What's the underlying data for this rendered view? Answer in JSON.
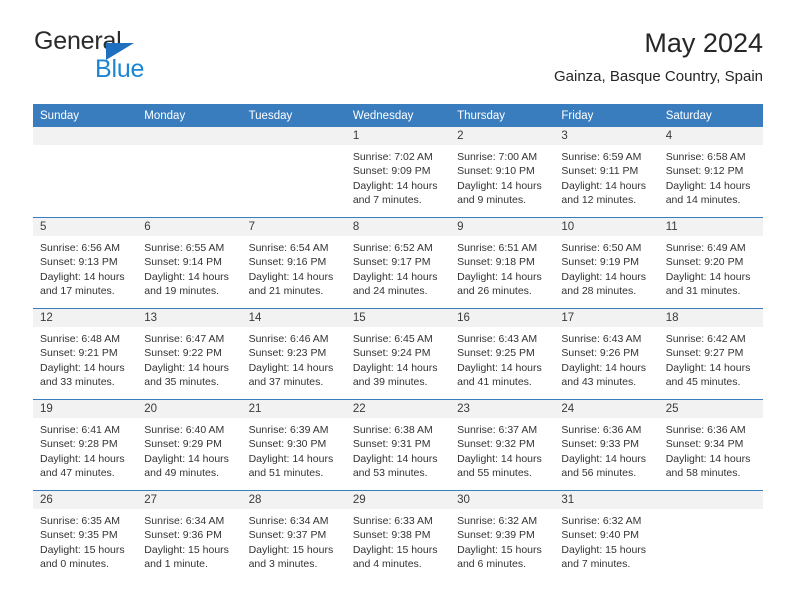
{
  "brand": {
    "name_part1": "General",
    "name_part2": "Blue",
    "logo_icon": "triangle-flag-icon",
    "color_dark": "#2b2b2b",
    "color_blue": "#1b87d4",
    "triangle_color": "#1f6fc0"
  },
  "header": {
    "title": "May 2024",
    "location": "Gainza, Basque Country, Spain"
  },
  "theme": {
    "header_band": "#3a7dbf",
    "date_band": "#f2f2f2",
    "text": "#333333",
    "header_text": "#ffffff"
  },
  "calendar": {
    "weekdays": [
      "Sunday",
      "Monday",
      "Tuesday",
      "Wednesday",
      "Thursday",
      "Friday",
      "Saturday"
    ],
    "weeks": [
      [
        {
          "date": "",
          "lines": []
        },
        {
          "date": "",
          "lines": []
        },
        {
          "date": "",
          "lines": []
        },
        {
          "date": "1",
          "lines": [
            "Sunrise: 7:02 AM",
            "Sunset: 9:09 PM",
            "Daylight: 14 hours",
            "and 7 minutes."
          ]
        },
        {
          "date": "2",
          "lines": [
            "Sunrise: 7:00 AM",
            "Sunset: 9:10 PM",
            "Daylight: 14 hours",
            "and 9 minutes."
          ]
        },
        {
          "date": "3",
          "lines": [
            "Sunrise: 6:59 AM",
            "Sunset: 9:11 PM",
            "Daylight: 14 hours",
            "and 12 minutes."
          ]
        },
        {
          "date": "4",
          "lines": [
            "Sunrise: 6:58 AM",
            "Sunset: 9:12 PM",
            "Daylight: 14 hours",
            "and 14 minutes."
          ]
        }
      ],
      [
        {
          "date": "5",
          "lines": [
            "Sunrise: 6:56 AM",
            "Sunset: 9:13 PM",
            "Daylight: 14 hours",
            "and 17 minutes."
          ]
        },
        {
          "date": "6",
          "lines": [
            "Sunrise: 6:55 AM",
            "Sunset: 9:14 PM",
            "Daylight: 14 hours",
            "and 19 minutes."
          ]
        },
        {
          "date": "7",
          "lines": [
            "Sunrise: 6:54 AM",
            "Sunset: 9:16 PM",
            "Daylight: 14 hours",
            "and 21 minutes."
          ]
        },
        {
          "date": "8",
          "lines": [
            "Sunrise: 6:52 AM",
            "Sunset: 9:17 PM",
            "Daylight: 14 hours",
            "and 24 minutes."
          ]
        },
        {
          "date": "9",
          "lines": [
            "Sunrise: 6:51 AM",
            "Sunset: 9:18 PM",
            "Daylight: 14 hours",
            "and 26 minutes."
          ]
        },
        {
          "date": "10",
          "lines": [
            "Sunrise: 6:50 AM",
            "Sunset: 9:19 PM",
            "Daylight: 14 hours",
            "and 28 minutes."
          ]
        },
        {
          "date": "11",
          "lines": [
            "Sunrise: 6:49 AM",
            "Sunset: 9:20 PM",
            "Daylight: 14 hours",
            "and 31 minutes."
          ]
        }
      ],
      [
        {
          "date": "12",
          "lines": [
            "Sunrise: 6:48 AM",
            "Sunset: 9:21 PM",
            "Daylight: 14 hours",
            "and 33 minutes."
          ]
        },
        {
          "date": "13",
          "lines": [
            "Sunrise: 6:47 AM",
            "Sunset: 9:22 PM",
            "Daylight: 14 hours",
            "and 35 minutes."
          ]
        },
        {
          "date": "14",
          "lines": [
            "Sunrise: 6:46 AM",
            "Sunset: 9:23 PM",
            "Daylight: 14 hours",
            "and 37 minutes."
          ]
        },
        {
          "date": "15",
          "lines": [
            "Sunrise: 6:45 AM",
            "Sunset: 9:24 PM",
            "Daylight: 14 hours",
            "and 39 minutes."
          ]
        },
        {
          "date": "16",
          "lines": [
            "Sunrise: 6:43 AM",
            "Sunset: 9:25 PM",
            "Daylight: 14 hours",
            "and 41 minutes."
          ]
        },
        {
          "date": "17",
          "lines": [
            "Sunrise: 6:43 AM",
            "Sunset: 9:26 PM",
            "Daylight: 14 hours",
            "and 43 minutes."
          ]
        },
        {
          "date": "18",
          "lines": [
            "Sunrise: 6:42 AM",
            "Sunset: 9:27 PM",
            "Daylight: 14 hours",
            "and 45 minutes."
          ]
        }
      ],
      [
        {
          "date": "19",
          "lines": [
            "Sunrise: 6:41 AM",
            "Sunset: 9:28 PM",
            "Daylight: 14 hours",
            "and 47 minutes."
          ]
        },
        {
          "date": "20",
          "lines": [
            "Sunrise: 6:40 AM",
            "Sunset: 9:29 PM",
            "Daylight: 14 hours",
            "and 49 minutes."
          ]
        },
        {
          "date": "21",
          "lines": [
            "Sunrise: 6:39 AM",
            "Sunset: 9:30 PM",
            "Daylight: 14 hours",
            "and 51 minutes."
          ]
        },
        {
          "date": "22",
          "lines": [
            "Sunrise: 6:38 AM",
            "Sunset: 9:31 PM",
            "Daylight: 14 hours",
            "and 53 minutes."
          ]
        },
        {
          "date": "23",
          "lines": [
            "Sunrise: 6:37 AM",
            "Sunset: 9:32 PM",
            "Daylight: 14 hours",
            "and 55 minutes."
          ]
        },
        {
          "date": "24",
          "lines": [
            "Sunrise: 6:36 AM",
            "Sunset: 9:33 PM",
            "Daylight: 14 hours",
            "and 56 minutes."
          ]
        },
        {
          "date": "25",
          "lines": [
            "Sunrise: 6:36 AM",
            "Sunset: 9:34 PM",
            "Daylight: 14 hours",
            "and 58 minutes."
          ]
        }
      ],
      [
        {
          "date": "26",
          "lines": [
            "Sunrise: 6:35 AM",
            "Sunset: 9:35 PM",
            "Daylight: 15 hours",
            "and 0 minutes."
          ]
        },
        {
          "date": "27",
          "lines": [
            "Sunrise: 6:34 AM",
            "Sunset: 9:36 PM",
            "Daylight: 15 hours",
            "and 1 minute."
          ]
        },
        {
          "date": "28",
          "lines": [
            "Sunrise: 6:34 AM",
            "Sunset: 9:37 PM",
            "Daylight: 15 hours",
            "and 3 minutes."
          ]
        },
        {
          "date": "29",
          "lines": [
            "Sunrise: 6:33 AM",
            "Sunset: 9:38 PM",
            "Daylight: 15 hours",
            "and 4 minutes."
          ]
        },
        {
          "date": "30",
          "lines": [
            "Sunrise: 6:32 AM",
            "Sunset: 9:39 PM",
            "Daylight: 15 hours",
            "and 6 minutes."
          ]
        },
        {
          "date": "31",
          "lines": [
            "Sunrise: 6:32 AM",
            "Sunset: 9:40 PM",
            "Daylight: 15 hours",
            "and 7 minutes."
          ]
        },
        {
          "date": "",
          "lines": []
        }
      ]
    ]
  }
}
